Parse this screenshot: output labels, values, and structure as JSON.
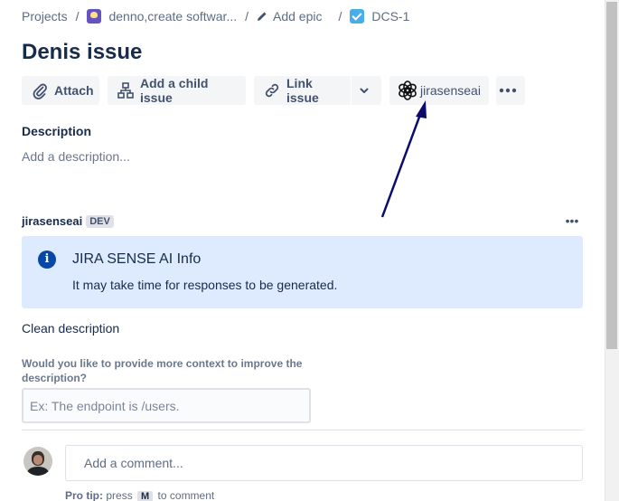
{
  "breadcrumb": {
    "projects": "Projects",
    "project": "denno,create softwar...",
    "epic": "Add epic",
    "issue_key": "DCS-1",
    "separator": "/"
  },
  "issue": {
    "title": "Denis issue"
  },
  "toolbar": {
    "attach": "Attach",
    "add_child": "Add a child issue",
    "link_issue": "Link issue",
    "app": "jirasenseai",
    "more_icon": "ellipsis-icon"
  },
  "description": {
    "label": "Description",
    "placeholder": "Add a description..."
  },
  "app_panel": {
    "name": "jirasenseai",
    "badge": "DEV",
    "more": "•••",
    "info_title": "JIRA SENSE AI Info",
    "info_text": "It may take time for responses to be generated.",
    "info_icon": "i",
    "clean_label": "Clean description",
    "context_question": "Would you like to provide more context to improve the description?",
    "context_placeholder": "Ex: The endpoint is /users."
  },
  "comment": {
    "placeholder": "Add a comment...",
    "protip_prefix": "Pro tip:",
    "protip_press": "press",
    "protip_key": "M",
    "protip_suffix": "to comment"
  },
  "colors": {
    "accent": "#0747a6",
    "info_bg": "#deebff",
    "button_bg": "#f4f5f7",
    "arrow": "#0b0b6b"
  }
}
